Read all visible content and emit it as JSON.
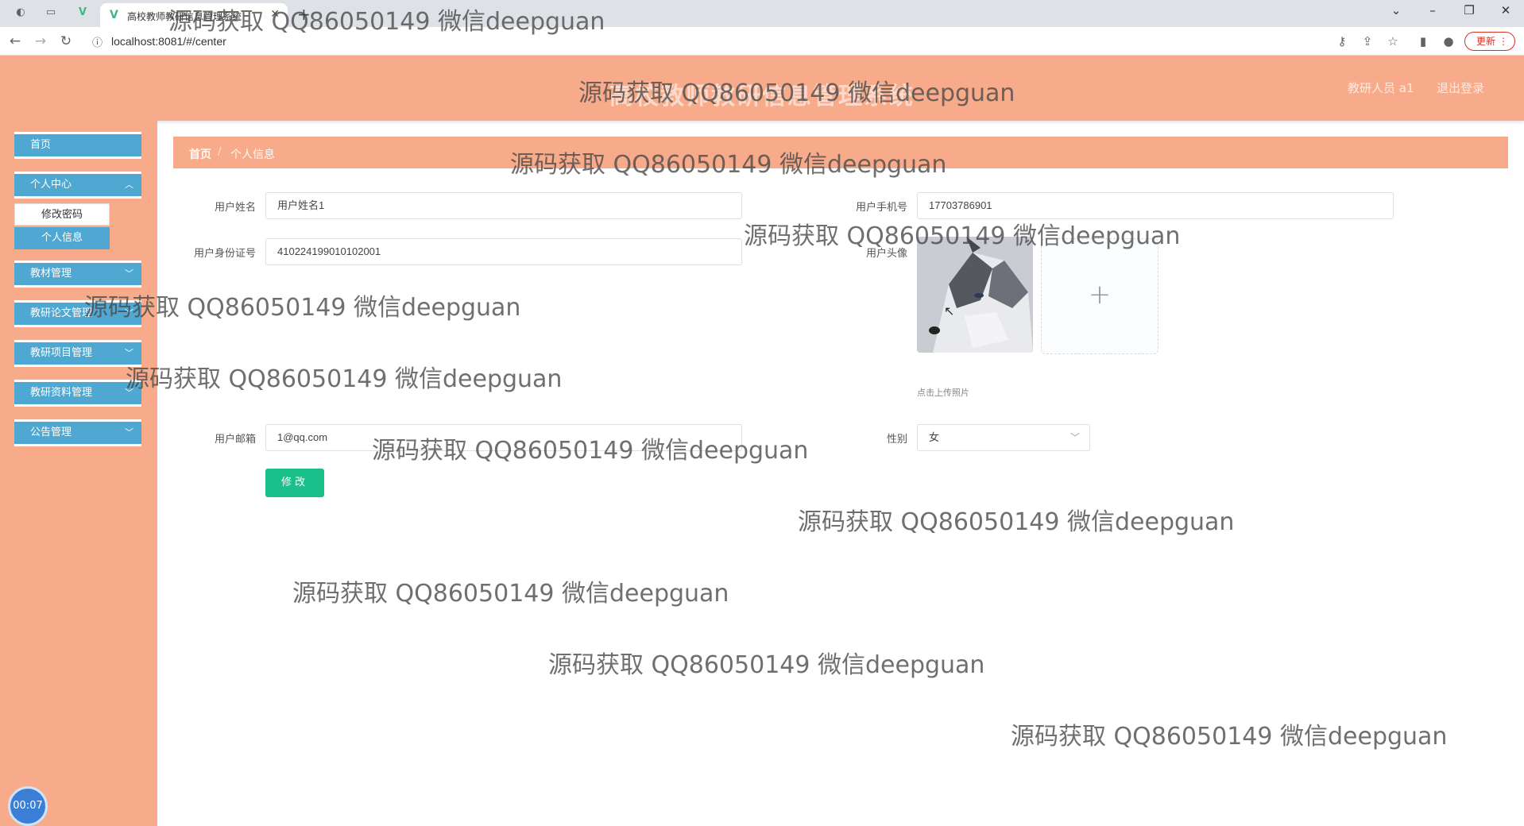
{
  "browser": {
    "tab_title": "高校教师教研信息管理系统",
    "url": "localhost:8081/#/center",
    "update_label": "更新"
  },
  "header": {
    "title": "高校教师教研信息管理系统",
    "user_label": "教研人员 a1",
    "logout_label": "退出登录"
  },
  "sidebar": {
    "items": [
      {
        "label": "首页"
      },
      {
        "label": "个人中心"
      },
      {
        "label": "教材管理"
      },
      {
        "label": "教研论文管理"
      },
      {
        "label": "教研项目管理"
      },
      {
        "label": "教研资料管理"
      },
      {
        "label": "公告管理"
      }
    ],
    "subitems": [
      {
        "label": "修改密码"
      },
      {
        "label": "个人信息"
      }
    ],
    "timer": "00:07"
  },
  "breadcrumb": {
    "home": "首页",
    "current": "个人信息"
  },
  "form": {
    "name_label": "用户姓名",
    "name_value": "用户姓名1",
    "phone_label": "用户手机号",
    "phone_value": "17703786901",
    "idcard_label": "用户身份证号",
    "idcard_value": "410224199010102001",
    "avatar_label": "用户头像",
    "upload_tip": "点击上传照片",
    "email_label": "用户邮箱",
    "email_value": "1@qq.com",
    "gender_label": "性别",
    "gender_value": "女",
    "submit_label": "修改"
  },
  "watermark": {
    "text": "源码获取 QQ86050149 微信deepguan"
  },
  "colors": {
    "header_bg": "#f8ab8a",
    "menu_bg": "#4ea8d2",
    "submit_bg": "#1bbf8a"
  }
}
